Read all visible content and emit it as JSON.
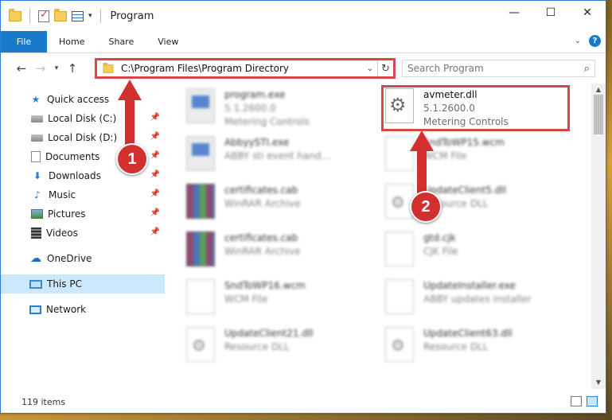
{
  "window": {
    "title": "Program",
    "controls": {
      "minimize": "—",
      "maximize": "☐",
      "close": "✕"
    }
  },
  "ribbon": {
    "tabs": [
      "File",
      "Home",
      "Share",
      "View"
    ],
    "help": "?"
  },
  "address": {
    "path": "C:\\Program Files\\Program Directory",
    "search_placeholder": "Search Program"
  },
  "nav": {
    "quick_access": "Quick access",
    "items": [
      {
        "label": "Local Disk (C:)",
        "icon": "disk-icon",
        "pinned": true
      },
      {
        "label": "Local Disk (D:)",
        "icon": "disk-icon",
        "pinned": true
      },
      {
        "label": "Documents",
        "icon": "documents-icon",
        "pinned": true
      },
      {
        "label": "Downloads",
        "icon": "downloads-icon",
        "pinned": true
      },
      {
        "label": "Music",
        "icon": "music-icon",
        "pinned": true
      },
      {
        "label": "Pictures",
        "icon": "pictures-icon",
        "pinned": true
      },
      {
        "label": "Videos",
        "icon": "videos-icon",
        "pinned": true
      }
    ],
    "onedrive": "OneDrive",
    "this_pc": "This PC",
    "network": "Network"
  },
  "files": [
    {
      "name": "program.exe",
      "line2": "5.1.2600.0",
      "line3": "Metering Controls",
      "icon": "exe"
    },
    {
      "name": "avmeter.dll",
      "line2": "5.1.2600.0",
      "line3": "Metering Controls",
      "icon": "gear"
    },
    {
      "name": "AbbyySTI.exe",
      "line2": "ABBY sti event hand...",
      "line3": "",
      "icon": "exe"
    },
    {
      "name": "SndToWP15.wcm",
      "line2": "WCM File",
      "line3": "",
      "icon": "blank"
    },
    {
      "name": "certificates.cab",
      "line2": "WinRAR Archive",
      "line3": "",
      "icon": "rar"
    },
    {
      "name": "UpdateClient5.dll",
      "line2": "Resource DLL",
      "line3": "",
      "icon": "dll"
    },
    {
      "name": "certificates.cab",
      "line2": "WinRAR Archive",
      "line3": "",
      "icon": "rar"
    },
    {
      "name": "gtd.cjk",
      "line2": "CJK File",
      "line3": "",
      "icon": "blank"
    },
    {
      "name": "SndToWP16.wcm",
      "line2": "WCM File",
      "line3": "",
      "icon": "blank"
    },
    {
      "name": "UpdateInstaller.exe",
      "line2": "ABBY updates installer",
      "line3": "",
      "icon": "blank"
    },
    {
      "name": "UpdateClient21.dll",
      "line2": "Resource DLL",
      "line3": "",
      "icon": "dll"
    },
    {
      "name": "UpdateClient63.dll",
      "line2": "Resource DLL",
      "line3": "",
      "icon": "dll"
    }
  ],
  "status": {
    "item_count": "119 items"
  },
  "callouts": {
    "one": "1",
    "two": "2"
  },
  "colors": {
    "accent": "#1979ca",
    "callout": "#d23030",
    "selection": "#cce8ff"
  }
}
